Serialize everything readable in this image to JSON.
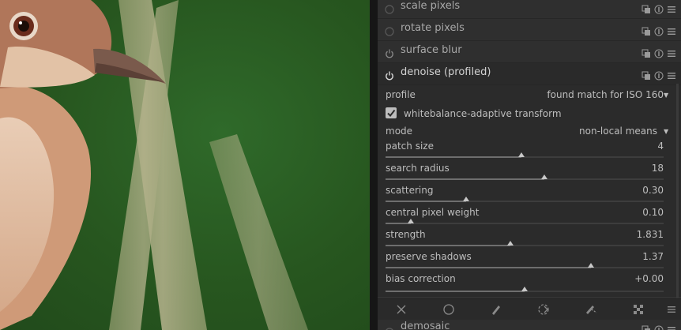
{
  "modules_top": [
    {
      "name": "scale pixels",
      "enabled": false
    },
    {
      "name": "rotate pixels",
      "enabled": false
    },
    {
      "name": "surface blur",
      "enabled": true
    }
  ],
  "active_module": {
    "name": "denoise (profiled)",
    "enabled": true
  },
  "profile": {
    "label": "profile",
    "value": "found match for ISO 160"
  },
  "wb_transform": {
    "label": "whitebalance-adaptive transform",
    "checked": true
  },
  "mode": {
    "label": "mode",
    "value": "non-local means"
  },
  "sliders": [
    {
      "label": "patch size",
      "value": "4",
      "position": 0.49
    },
    {
      "label": "search radius",
      "value": "18",
      "position": 0.57
    },
    {
      "label": "scattering",
      "value": "0.30",
      "position": 0.29
    },
    {
      "label": "central pixel weight",
      "value": "0.10",
      "position": 0.09
    },
    {
      "label": "strength",
      "value": "1.831",
      "position": 0.45
    },
    {
      "label": "preserve shadows",
      "value": "1.37",
      "position": 0.74
    },
    {
      "label": "bias correction",
      "value": "+0.00",
      "position": 0.5
    }
  ],
  "toolbar_icons": [
    "close-icon",
    "circle-mask-icon",
    "drawn-mask-icon",
    "parametric-mask-icon",
    "drawn-parametric-mask-icon",
    "raster-mask-icon",
    "menu-icon"
  ],
  "module_bottom": {
    "name": "demosaic",
    "enabled": false
  },
  "colors": {
    "panel_bg": "#333333",
    "module_body": "#2b2b2b",
    "text": "#bdbdbd",
    "photo_green": "#27561f"
  }
}
